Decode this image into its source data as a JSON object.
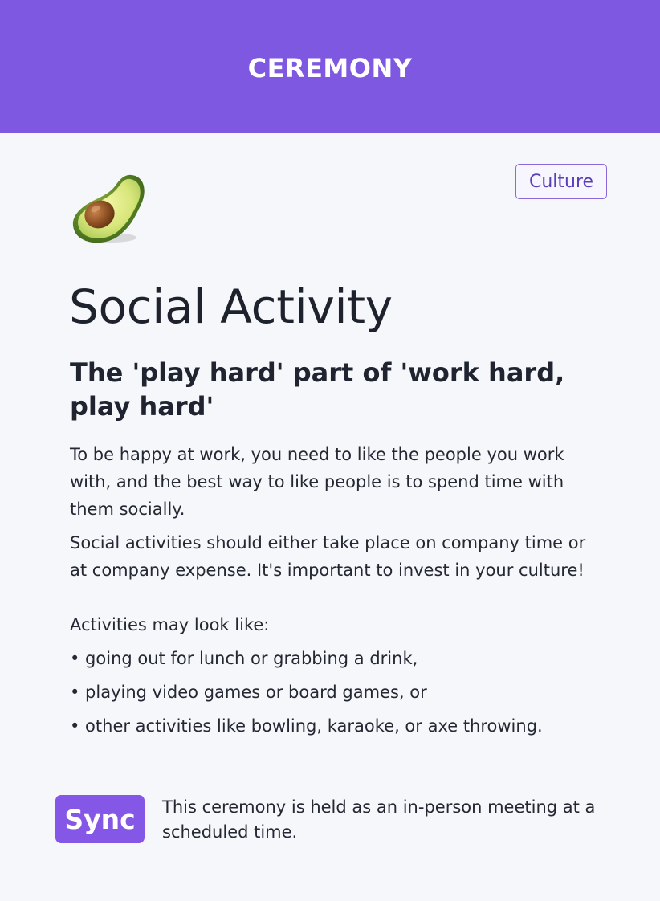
{
  "header": {
    "title": "CEREMONY",
    "background_color": "#7f58e1"
  },
  "category_badge": {
    "label": "Culture"
  },
  "icon": {
    "name": "avocado-icon"
  },
  "title": "Social Activity",
  "subtitle": "The 'play hard' part of 'work hard, play hard'",
  "body": {
    "paragraphs": [
      "To be happy at work, you need to like the people you work with, and the best way to like people is to spend time with them socially.",
      "Social activities should either take place on company time or at company expense. It's important to invest in your culture!"
    ],
    "list_intro": "Activities may look like:",
    "bullets": [
      "• going out for lunch or grabbing a drink,",
      "• playing video games or board games, or",
      "• other activities like bowling, karaoke, or axe throwing."
    ]
  },
  "sync": {
    "badge_label": "Sync",
    "description": "This ceremony is held as an in-person meeting at a scheduled time.",
    "badge_color": "#8557e6"
  }
}
